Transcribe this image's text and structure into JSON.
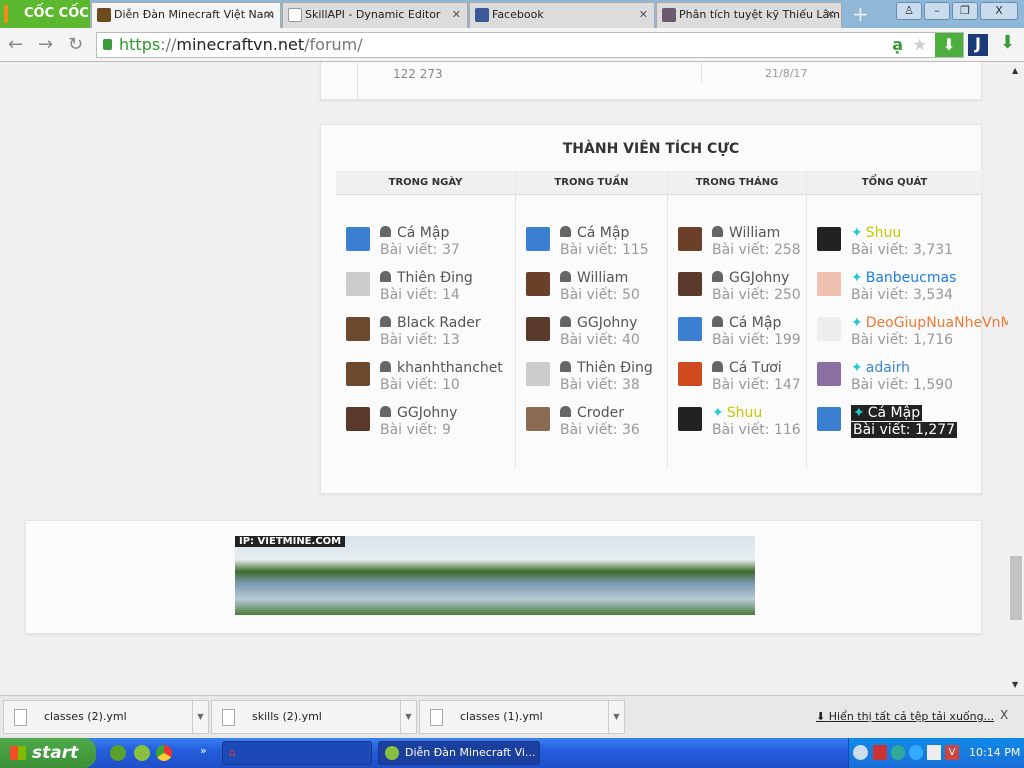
{
  "browser": {
    "brand": "CỐC CỐC",
    "tabs": [
      {
        "label": "Diễn Đàn Minecraft Việt Nam",
        "active": true
      },
      {
        "label": "SkillAPI - Dynamic Editor"
      },
      {
        "label": "Facebook"
      },
      {
        "label": "Phân tích tuyệt kỹ Thiếu Lâm"
      }
    ],
    "url_scheme": "https",
    "url_sep": "://",
    "url_host": "minecraftvn.net",
    "url_path": "/forum/"
  },
  "prev_panel": {
    "counts": "122   273",
    "date": "21/8/17"
  },
  "members": {
    "title": "THÀNH VIÊN TÍCH CỰC",
    "posts_label": "Bài viết:",
    "columns": [
      {
        "header": "TRONG NGÀY",
        "rows": [
          {
            "name": "Cá Mập",
            "posts": "37",
            "av": "#3a7fd0"
          },
          {
            "name": "Thiên Đing",
            "posts": "14",
            "av": "#ccc"
          },
          {
            "name": "Black Rader",
            "posts": "13",
            "av": "#6b4a30"
          },
          {
            "name": "khanhthanchet",
            "posts": "10",
            "av": "#6b4a30"
          },
          {
            "name": "GGJohny",
            "posts": "9",
            "av": "#5a3a2a"
          }
        ]
      },
      {
        "header": "TRONG TUẦN",
        "rows": [
          {
            "name": "Cá Mập",
            "posts": "115",
            "av": "#3a7fd0"
          },
          {
            "name": "William",
            "posts": "50",
            "av": "#6a4028"
          },
          {
            "name": "GGJohny",
            "posts": "40",
            "av": "#5a3a2a"
          },
          {
            "name": "Thiên Đing",
            "posts": "38",
            "av": "#ccc"
          },
          {
            "name": "Croder",
            "posts": "36",
            "av": "#8a6a50"
          }
        ]
      },
      {
        "header": "TRONG THÁNG",
        "rows": [
          {
            "name": "William",
            "posts": "258",
            "av": "#6a4028"
          },
          {
            "name": "GGJohny",
            "posts": "250",
            "av": "#5a3a2a"
          },
          {
            "name": "Cá Mập",
            "posts": "199",
            "av": "#3a7fd0"
          },
          {
            "name": "Cá Tươi",
            "posts": "147",
            "av": "#d04a20"
          },
          {
            "name": "Shuu",
            "posts": "116",
            "av": "#222",
            "color": "#c8c800"
          }
        ]
      },
      {
        "header": "TỔNG QUÁT",
        "rows": [
          {
            "name": "Shuu",
            "posts": "3,731",
            "av": "#222",
            "color": "#c8c800"
          },
          {
            "name": "Banbeucmas",
            "posts": "3,534",
            "av": "#f0c0b0",
            "color": "#1e7ee0"
          },
          {
            "name": "DeoGiupNuaNheVnM",
            "posts": "1,716",
            "av": "#eee",
            "color": "#f07830"
          },
          {
            "name": "adairh",
            "posts": "1,590",
            "av": "#8a70a0",
            "color": "#3a8ad0"
          },
          {
            "name": "Cá Mập",
            "posts": "1,277",
            "av": "#3a7fd0",
            "color": "#fff",
            "highlight": true
          }
        ]
      }
    ]
  },
  "banner": {
    "text": "IP: VIETMINE.COM"
  },
  "downloads": {
    "items": [
      "classes (2).yml",
      "skills (2).yml",
      "classes (1).yml"
    ],
    "show_all": "Hiển thị tất cả tệp tải xuống...",
    "close": "X"
  },
  "taskbar": {
    "start": "start",
    "window": "Diễn Đàn Minecraft Vi...",
    "clock": "10:14 PM"
  }
}
